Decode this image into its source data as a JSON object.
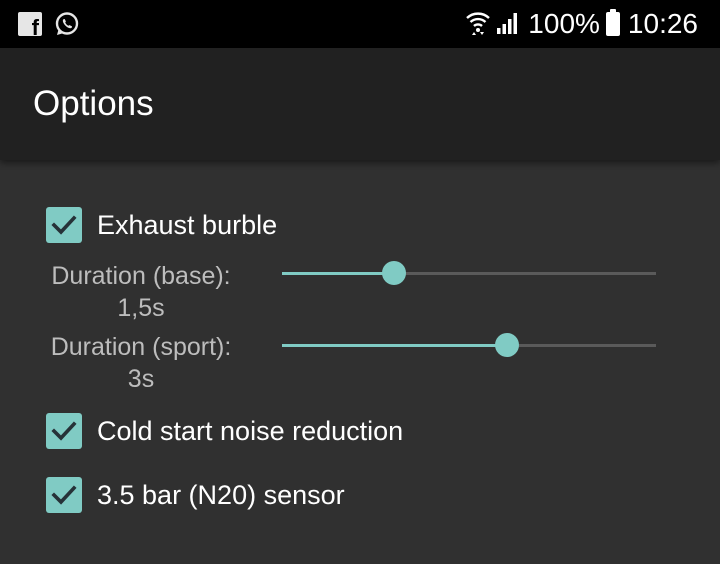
{
  "status_bar": {
    "battery_percent": "100%",
    "time": "10:26",
    "icons": [
      "facebook-icon",
      "whatsapp-icon",
      "wifi-icon",
      "signal-icon",
      "battery-icon"
    ]
  },
  "app_bar": {
    "title": "Options"
  },
  "options": {
    "exhaust_burble": {
      "label": "Exhaust burble",
      "checked": true
    },
    "duration_base": {
      "label": "Duration (base):",
      "value": "1,5s",
      "fraction": 0.3
    },
    "duration_sport": {
      "label": "Duration (sport):",
      "value": "3s",
      "fraction": 0.6
    },
    "cold_start": {
      "label": "Cold start noise reduction",
      "checked": true
    },
    "sensor": {
      "label": "3.5 bar (N20) sensor",
      "checked": true
    }
  },
  "colors": {
    "accent": "#80cbc4",
    "app_bar": "#212121",
    "background": "#303030",
    "status_bar": "#000000"
  }
}
